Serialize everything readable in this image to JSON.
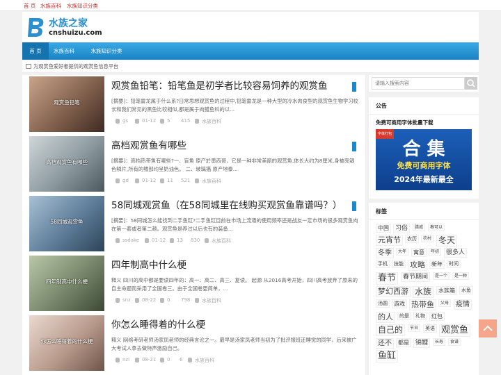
{
  "topbar": {
    "links": [
      "首 页",
      "水族百科",
      "水族知识分类"
    ]
  },
  "logo": {
    "cn": "水族之家",
    "en": "cnshuizu.com",
    "mark_color": "#2c8fd0"
  },
  "nav": {
    "items": [
      "首 页",
      "水族百科",
      "水族知识分类"
    ],
    "active": 0,
    "color": "#1b83c4"
  },
  "notice": {
    "icon": "mail-icon",
    "text": "为观赏鱼爱好者提供的观赏鱼信息平台"
  },
  "articles": [
    {
      "thumb_label": "观赏鱼铅笔",
      "title": "观赏鱼铅笔：铅笔鱼是初学者比较容易饲养的观赏鱼",
      "summary": "[摘要]：铅笔雷龙属于什么系?日常思想观赏鱼的过程中,铅笔雷龙是一种大型的冷水肉食型的观赏鱼生物学习校长和我们常见的黑鱼比较相似,都是属于肉鳢鱼科的以...",
      "author": "gs",
      "date": "01-12",
      "views": "5",
      "comments": "415",
      "category": "水族百科"
    },
    {
      "thumb_label": "高档观赏鱼有哪些",
      "title": "高档观赏鱼有哪些",
      "summary": "[摘要]：高档热带鱼有哪些?一、盲鱼 原产於墨西哥，它是一种非常美丽的观赏鱼,体长大约为8厘米,身被亮银色鳞片,所有的鳍部均呈奶油色。 二、玻璃猫 原产地泰...",
      "author": "gd",
      "date": "01-12",
      "views": "11",
      "comments": "521",
      "category": "水族百科"
    },
    {
      "thumb_label": "58同城观赏鱼",
      "title": "58同城观赏鱼（在58同城里在线购买观赏鱼靠谱吗？）",
      "summary": "[摘要]：58同城怎么能找到二手鱼缸?二手鱼缸目前在市场上流通的使用频率还是战友一定市场的很多观赏鱼肉在第一套或者第二趟。观赏鱼是养过以后也有的装备...",
      "author": "ssdake",
      "date": "01-12",
      "views": "13",
      "comments": "830",
      "category": "水族百科"
    },
    {
      "thumb_label": "四年制高中什么梗",
      "title": "四年制高中什么梗",
      "summary": "释义 四川的高中都是要读四年的：高一、高二、高三、复读。 起源 从2016高考开始，四川高考放弃了原来的自主命题而采用了全国卷三。由于全国卷更简单，...",
      "author": "snz",
      "date": "08-22",
      "views": "0",
      "comments": "798",
      "category": "水族百科"
    },
    {
      "thumb_label": "你怎么睡得着的什么梗",
      "title": "你怎么睡得着的什么梗",
      "summary": "释义 网络考研老师汤家凤老师的经典言论之一。最早是汤家凤老师当初为了批评报班还睡觉的同学，后来被广大考试人拿去做特声激励自己。",
      "author": "nzl",
      "date": "08-21",
      "views": "0",
      "comments": "6",
      "category": "水族百科"
    }
  ],
  "search": {
    "placeholder": "请输入搜索内容",
    "icon": "search-icon"
  },
  "announce": {
    "title": "公告",
    "ad_title": "免费可商用字体批量下载",
    "ribbon": "字体打包",
    "big": "合 集",
    "mid": "免费可商用字体",
    "bot": "2024年最新最全"
  },
  "tags_panel": {
    "title": "标签",
    "tags": [
      {
        "t": "中国",
        "s": 8
      },
      {
        "t": "习俗",
        "s": 9
      },
      {
        "t": "腊戚",
        "s": 6
      },
      {
        "t": "春可以",
        "s": 6
      },
      {
        "t": "元宵节",
        "s": 11
      },
      {
        "t": "农历",
        "s": 7
      },
      {
        "t": "农村",
        "s": 6
      },
      {
        "t": "冬天",
        "s": 12
      },
      {
        "t": "冬季",
        "s": 10
      },
      {
        "t": "大年",
        "s": 6
      },
      {
        "t": "寓意",
        "s": 8
      },
      {
        "t": "年初",
        "s": 6
      },
      {
        "t": "很多人",
        "s": 9
      },
      {
        "t": "手机",
        "s": 7
      },
      {
        "t": "技能",
        "s": 7
      },
      {
        "t": "攻略",
        "s": 11
      },
      {
        "t": "新年",
        "s": 8
      },
      {
        "t": "时间",
        "s": 7
      },
      {
        "t": "春节",
        "s": 13
      },
      {
        "t": "春节期间",
        "s": 9
      },
      {
        "t": "是一个",
        "s": 6
      },
      {
        "t": "是一种",
        "s": 6
      },
      {
        "t": "梦幻西游",
        "s": 11
      },
      {
        "t": "水族",
        "s": 12
      },
      {
        "t": "水族箱",
        "s": 8
      },
      {
        "t": "水鱼",
        "s": 7
      },
      {
        "t": "汤圆",
        "s": 7
      },
      {
        "t": "游戏",
        "s": 8
      },
      {
        "t": "热带鱼",
        "s": 11
      },
      {
        "t": "父母",
        "s": 6
      },
      {
        "t": "疫情",
        "s": 10
      },
      {
        "t": "的人",
        "s": 11
      },
      {
        "t": "的是",
        "s": 7
      },
      {
        "t": "礼物",
        "s": 7
      },
      {
        "t": "红包",
        "s": 8
      },
      {
        "t": "自己的",
        "s": 12
      },
      {
        "t": "节日",
        "s": 6
      },
      {
        "t": "英语",
        "s": 7
      },
      {
        "t": "观赏鱼",
        "s": 13
      },
      {
        "t": "还不",
        "s": 10
      },
      {
        "t": "都是",
        "s": 8
      },
      {
        "t": "锦鲤",
        "s": 9
      },
      {
        "t": "长寿",
        "s": 6
      },
      {
        "t": "食谱",
        "s": 6
      },
      {
        "t": "鱼缸",
        "s": 13
      }
    ]
  },
  "back_to_top": {
    "icon": "arrow-up-icon",
    "color": "#f5a58a"
  }
}
